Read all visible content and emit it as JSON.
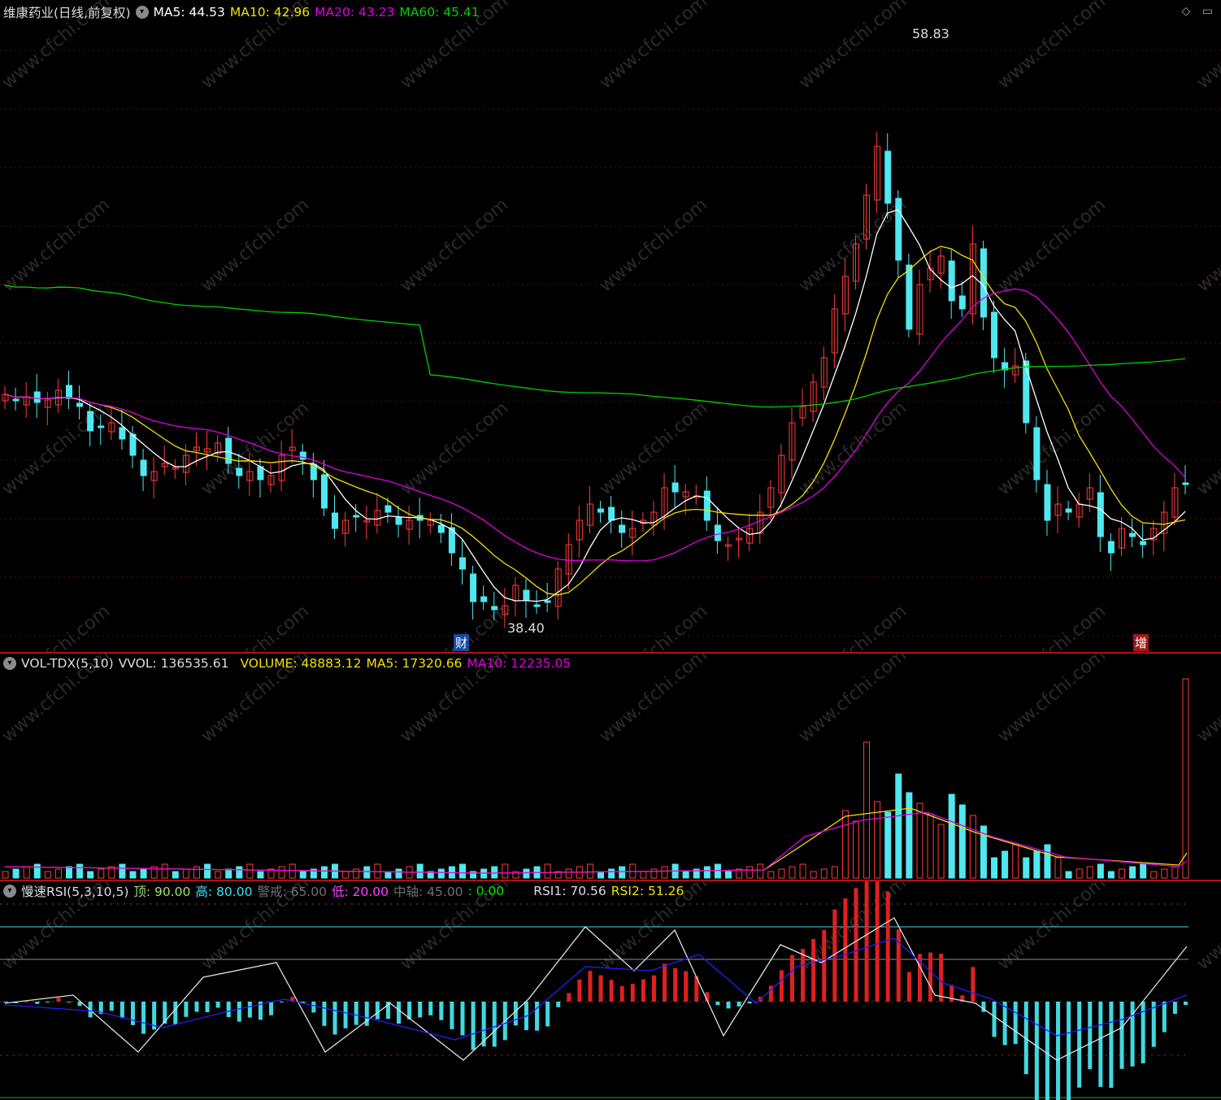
{
  "main": {
    "title": "维康药业(日线,前复权)",
    "ma5": "MA5: 44.53",
    "ma10": "MA10: 42.96",
    "ma20": "MA20: 43.23",
    "ma60": "MA60: 45.41",
    "high_label": "58.83",
    "low_label": "38.40",
    "tag_left": "财",
    "tag_right": "增"
  },
  "volume": {
    "name": "VOL-TDX(5,10)",
    "vvol": "VVOL: 136535.61",
    "volume": "VOLUME: 48883.12",
    "ma5": "MA5: 17320.66",
    "ma10": "MA10: 12235.05"
  },
  "rsi": {
    "name": "慢速RSI(5,3,10,5)",
    "top": "顶: 90.00",
    "high": "高: 80.00",
    "warn": "警戒: 65.00",
    "low": "低: 20.00",
    "axis": "中轴: 45.00",
    "zero": ": 0.00",
    "rsi1": "RSI1: 70.56",
    "rsi2": "RSI2: 51.26"
  },
  "watermark": "www.cfchi.com",
  "colors": {
    "up": "#ff3c3c",
    "down": "#4fe8f0",
    "ma5": "#ffffff",
    "ma10": "#f0e000",
    "ma20": "#e000e0",
    "ma60": "#00d000"
  }
}
